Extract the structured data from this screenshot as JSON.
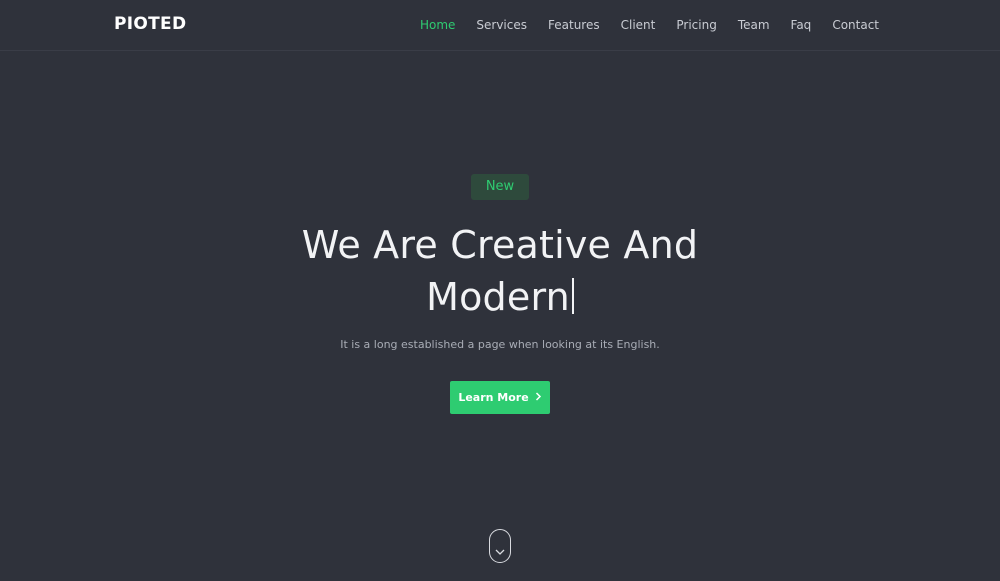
{
  "brand": {
    "name": "PIOTED"
  },
  "nav": {
    "items": [
      {
        "label": "Home",
        "active": true
      },
      {
        "label": "Services"
      },
      {
        "label": "Features"
      },
      {
        "label": "Client"
      },
      {
        "label": "Pricing"
      },
      {
        "label": "Team"
      },
      {
        "label": "Faq"
      },
      {
        "label": "Contact"
      }
    ]
  },
  "hero": {
    "badge": "New",
    "title_line1": "We Are Creative And",
    "title_line2": "Modern",
    "subtitle": "It is a long established a page when looking at its English.",
    "cta_label": "Learn More",
    "cta_icon": "chevron-right-icon"
  },
  "scroll_indicator": {
    "icon": "chevron-down-icon"
  },
  "colors": {
    "background": "#2f323b",
    "accent": "#2ecc71",
    "text": "#f2f3f5",
    "muted": "#a9adb6"
  }
}
